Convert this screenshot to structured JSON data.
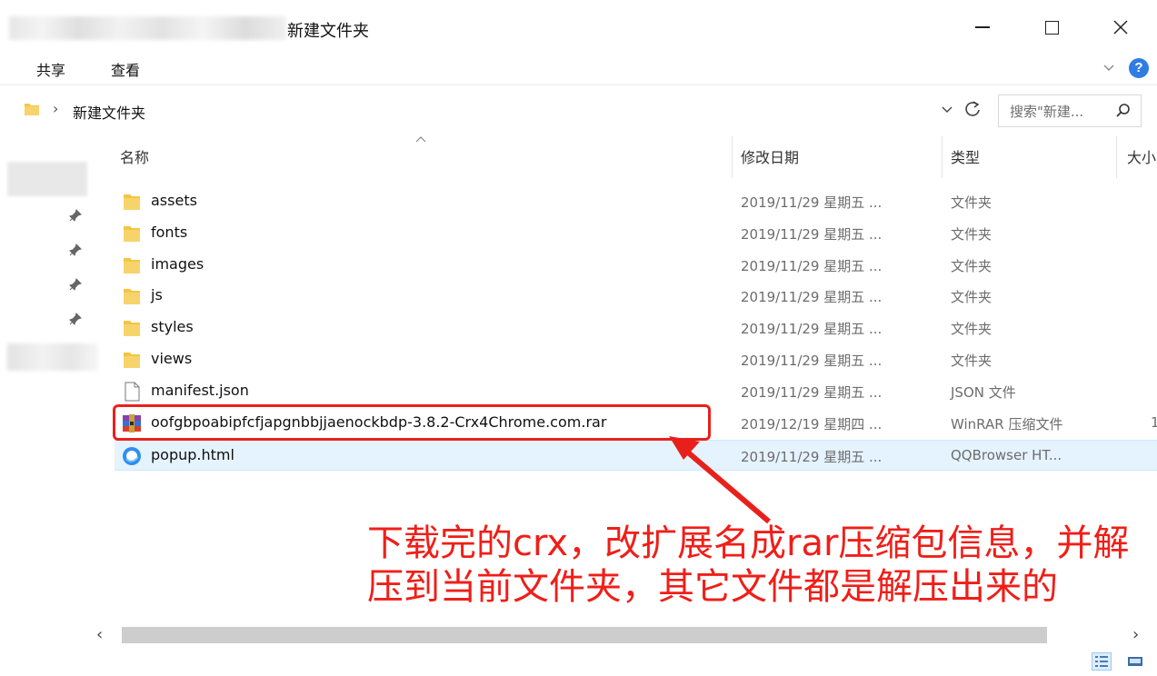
{
  "window": {
    "title": "新建文件夹",
    "controls": {
      "minimize": "minimize-icon",
      "maximize": "maximize-icon",
      "close": "close-icon"
    }
  },
  "ribbon": {
    "tabs": [
      {
        "label": "共享"
      },
      {
        "label": "查看"
      }
    ],
    "help_label": "?"
  },
  "address": {
    "separator": "›",
    "path": "新建文件夹",
    "search_placeholder": "搜索\"新建..."
  },
  "columns": {
    "name": "名称",
    "date": "修改日期",
    "type": "类型",
    "size": "大小"
  },
  "files": [
    {
      "name": "assets",
      "date": "2019/11/29 星期五 ...",
      "type": "文件夹",
      "size": "",
      "icon": "folder-icon"
    },
    {
      "name": "fonts",
      "date": "2019/11/29 星期五 ...",
      "type": "文件夹",
      "size": "",
      "icon": "folder-icon"
    },
    {
      "name": "images",
      "date": "2019/11/29 星期五 ...",
      "type": "文件夹",
      "size": "",
      "icon": "folder-icon"
    },
    {
      "name": "js",
      "date": "2019/11/29 星期五 ...",
      "type": "文件夹",
      "size": "",
      "icon": "folder-icon"
    },
    {
      "name": "styles",
      "date": "2019/11/29 星期五 ...",
      "type": "文件夹",
      "size": "",
      "icon": "folder-icon"
    },
    {
      "name": "views",
      "date": "2019/11/29 星期五 ...",
      "type": "文件夹",
      "size": "",
      "icon": "folder-icon"
    },
    {
      "name": "manifest.json",
      "date": "2019/11/29 星期五 ...",
      "type": "JSON 文件",
      "size": "",
      "icon": "document-icon"
    },
    {
      "name": "oofgbpoabipfcfjapgnbbjjaenockbdp-3.8.2-Crx4Chrome.com.rar",
      "date": "2019/12/19 星期四 ...",
      "type": "WinRAR 压缩文件",
      "size": "1",
      "icon": "winrar-archive-icon"
    },
    {
      "name": "popup.html",
      "date": "2019/11/29 星期五 ...",
      "type": "QQBrowser HT...",
      "size": "",
      "icon": "qqbrowser-html-icon",
      "selected": true
    }
  ],
  "annotation": {
    "text": "下载完的crx，改扩展名成rar压缩包信息，并解压到当前文件夹，其它文件都是解压出来的",
    "color": "#f01e18"
  },
  "colors": {
    "accent": "#2f7de1",
    "selection": "#e5f3ff",
    "highlight": "#e8201c"
  }
}
